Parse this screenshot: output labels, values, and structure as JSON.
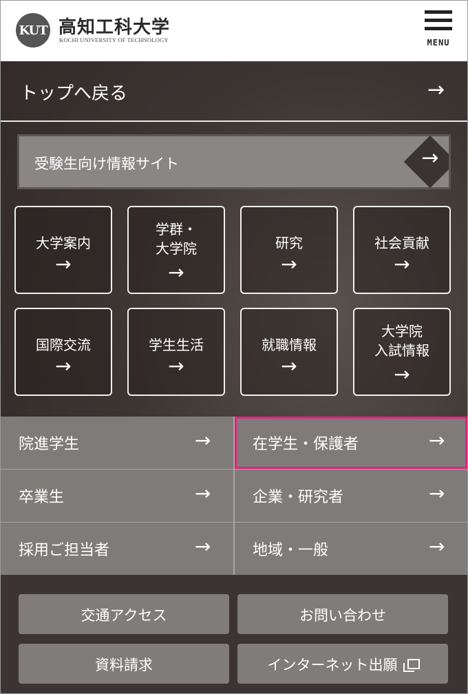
{
  "header": {
    "logo_mark": "KUT",
    "logo_name": "高知工科大学",
    "logo_sub": "KOCHI UNIVERSITY OF TECHNOLOGY",
    "menu_label": "MENU"
  },
  "back": {
    "label": "トップへ戻る",
    "arrow": "→"
  },
  "exam_site": {
    "label": "受験生向け情報サイト",
    "arrow": "→"
  },
  "tiles": [
    {
      "label": "大学案内",
      "arrow": "→"
    },
    {
      "label": "学群・\n大学院",
      "arrow": "→"
    },
    {
      "label": "研究",
      "arrow": "→"
    },
    {
      "label": "社会貢献",
      "arrow": "→"
    },
    {
      "label": "国際交流",
      "arrow": "→"
    },
    {
      "label": "学生生活",
      "arrow": "→"
    },
    {
      "label": "就職情報",
      "arrow": "→"
    },
    {
      "label": "大学院\n入試情報",
      "arrow": "→"
    }
  ],
  "nav": [
    {
      "label": "院進学生",
      "arrow": "→"
    },
    {
      "label": "在学生・保護者",
      "arrow": "→"
    },
    {
      "label": "卒業生",
      "arrow": "→"
    },
    {
      "label": "企業・研究者",
      "arrow": "→"
    },
    {
      "label": "採用ご担当者",
      "arrow": "→"
    },
    {
      "label": "地域・一般",
      "arrow": "→"
    }
  ],
  "buttons": [
    {
      "label": "交通アクセス"
    },
    {
      "label": "お問い合わせ"
    },
    {
      "label": "資料請求"
    },
    {
      "label": "インターネット出願"
    }
  ],
  "colors": {
    "highlight": "#e6217f",
    "panel": "#3b3432",
    "nav_bg": "#7e7b79"
  }
}
